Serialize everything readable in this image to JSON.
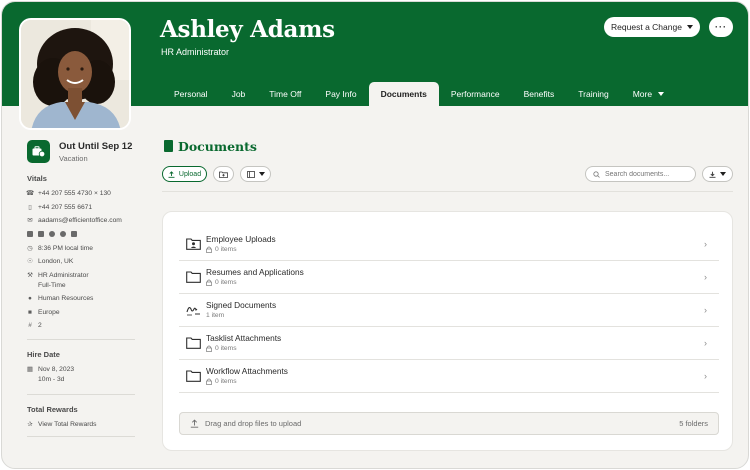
{
  "profile": {
    "name": "Ashley Adams",
    "title": "HR Administrator",
    "request_label": "Request a Change",
    "more_label": "···"
  },
  "tabs": [
    {
      "label": "Personal",
      "active": false
    },
    {
      "label": "Job",
      "active": false
    },
    {
      "label": "Time Off",
      "active": false
    },
    {
      "label": "Pay Info",
      "active": false
    },
    {
      "label": "Documents",
      "active": true
    },
    {
      "label": "Performance",
      "active": false
    },
    {
      "label": "Benefits",
      "active": false
    },
    {
      "label": "Training",
      "active": false
    },
    {
      "label": "More",
      "active": false
    }
  ],
  "status": {
    "title": "Out Until Sep 12",
    "subtitle": "Vacation"
  },
  "vitals": {
    "heading": "Vitals",
    "work_phone": "+44 207 555 4730 × 130",
    "mobile_phone": "+44 207 555 6671",
    "email": "aadams@efficientoffice.com",
    "local_time": "8:36 PM local time",
    "location": "London, UK",
    "job_title": "HR Administrator",
    "employment_type": "Full-Time",
    "department": "Human Resources",
    "division": "Europe",
    "employee_number": "2"
  },
  "hire": {
    "heading": "Hire Date",
    "date": "Nov 8, 2023",
    "tenure": "10m - 3d"
  },
  "rewards": {
    "heading": "Total Rewards",
    "link": "View Total Rewards"
  },
  "documents": {
    "title": "Documents",
    "upload_label": "Upload",
    "search_placeholder": "Search documents...",
    "folders": [
      {
        "name": "Employee Uploads",
        "meta": "0 items",
        "icon": "folder-user-icon",
        "locked": true
      },
      {
        "name": "Resumes and Applications",
        "meta": "0 items",
        "icon": "folder-icon",
        "locked": true
      },
      {
        "name": "Signed Documents",
        "meta": "1 item",
        "icon": "signature-icon",
        "locked": false
      },
      {
        "name": "Tasklist Attachments",
        "meta": "0 items",
        "icon": "folder-icon",
        "locked": true
      },
      {
        "name": "Workflow Attachments",
        "meta": "0 items",
        "icon": "folder-icon",
        "locked": true
      }
    ],
    "dropzone_label": "Drag and drop files to upload",
    "folder_count": "5 folders"
  },
  "colors": {
    "brand_green": "#09692f",
    "background": "#f4f3f0"
  }
}
